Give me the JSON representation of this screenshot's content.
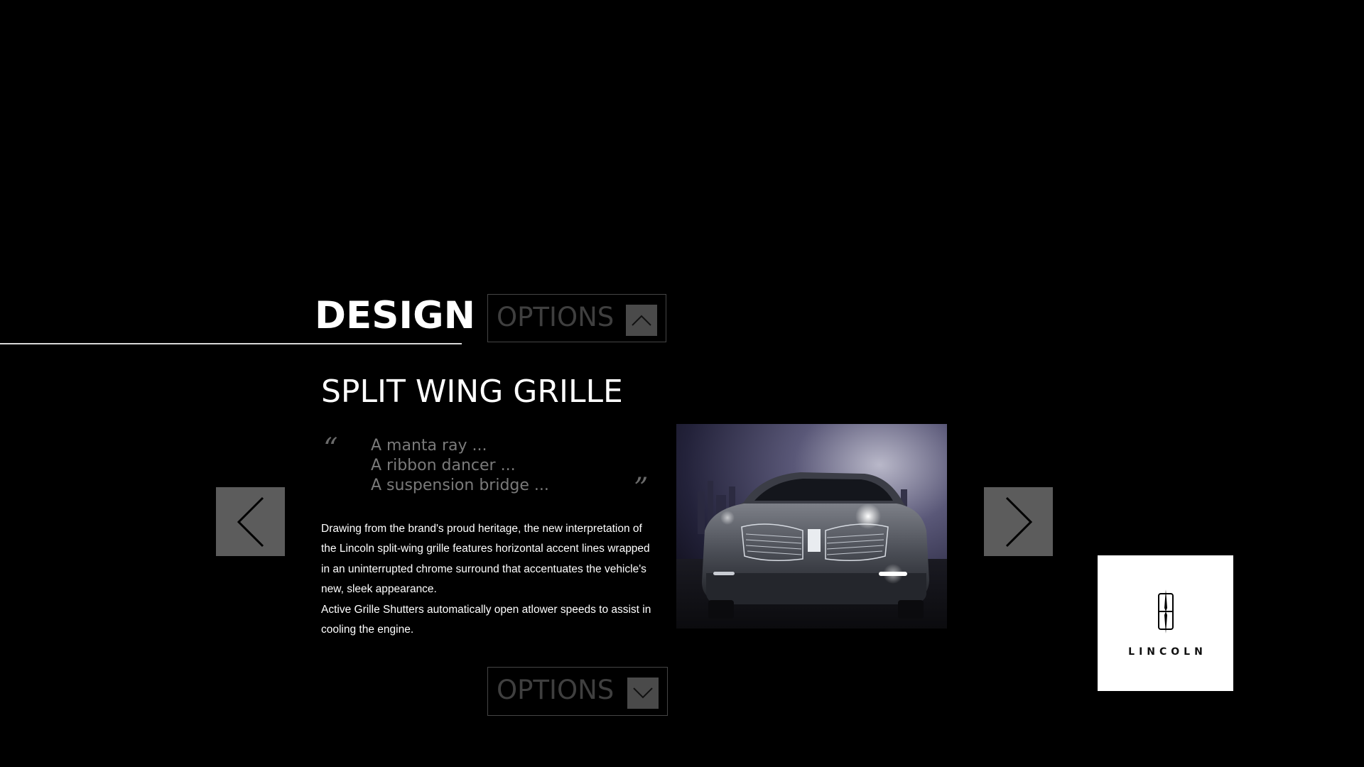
{
  "section": {
    "title": "DESIGN"
  },
  "options_top": {
    "label": "OPTIONS",
    "icon": "chevron-up-icon"
  },
  "feature": {
    "title": "SPLIT WING GRILLE",
    "quote_open": "“",
    "quote_close": "”",
    "quote_lines": [
      "A manta ray ...",
      "A ribbon dancer ...",
      "A suspension bridge ..."
    ],
    "paragraphs": [
      "Drawing from the brand's proud heritage, the new interpretation of the Lincoln split-wing grille features horizontal accent lines wrapped in an uninterrupted chrome surround that accentuates the vehicle's new, sleek appearance.",
      "Active Grille Shutters automatically open atlower speeds to assist in cooling the engine."
    ]
  },
  "options_bottom": {
    "label": "OPTIONS",
    "icon": "chevron-down-icon"
  },
  "nav": {
    "prev_icon": "chevron-left-icon",
    "next_icon": "chevron-right-icon"
  },
  "image": {
    "subject": "car-front-photo"
  },
  "logo": {
    "wordmark": "LINCOLN",
    "icon": "lincoln-star-icon"
  },
  "colors": {
    "background": "#000000",
    "nav_button": "#5c5c5c",
    "options_text": "#3f3f3f",
    "quote_text": "#7a7a7a"
  }
}
